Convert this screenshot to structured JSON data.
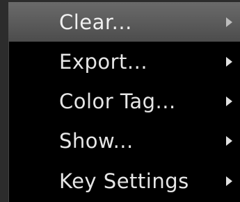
{
  "menu": {
    "items": [
      {
        "label": "Clear...",
        "has_submenu": true,
        "highlighted": true,
        "icon": "chevron-right-icon"
      },
      {
        "label": "Export...",
        "has_submenu": true,
        "highlighted": false,
        "icon": "chevron-right-icon"
      },
      {
        "label": "Color Tag...",
        "has_submenu": true,
        "highlighted": false,
        "icon": "chevron-right-icon"
      },
      {
        "label": "Show...",
        "has_submenu": true,
        "highlighted": false,
        "icon": "chevron-right-icon"
      },
      {
        "label": "Key Settings",
        "has_submenu": true,
        "highlighted": false,
        "icon": "chevron-right-icon"
      }
    ]
  },
  "colors": {
    "background": "#000000",
    "highlight": "#5a5a5a",
    "text": "#e6e6e6"
  }
}
